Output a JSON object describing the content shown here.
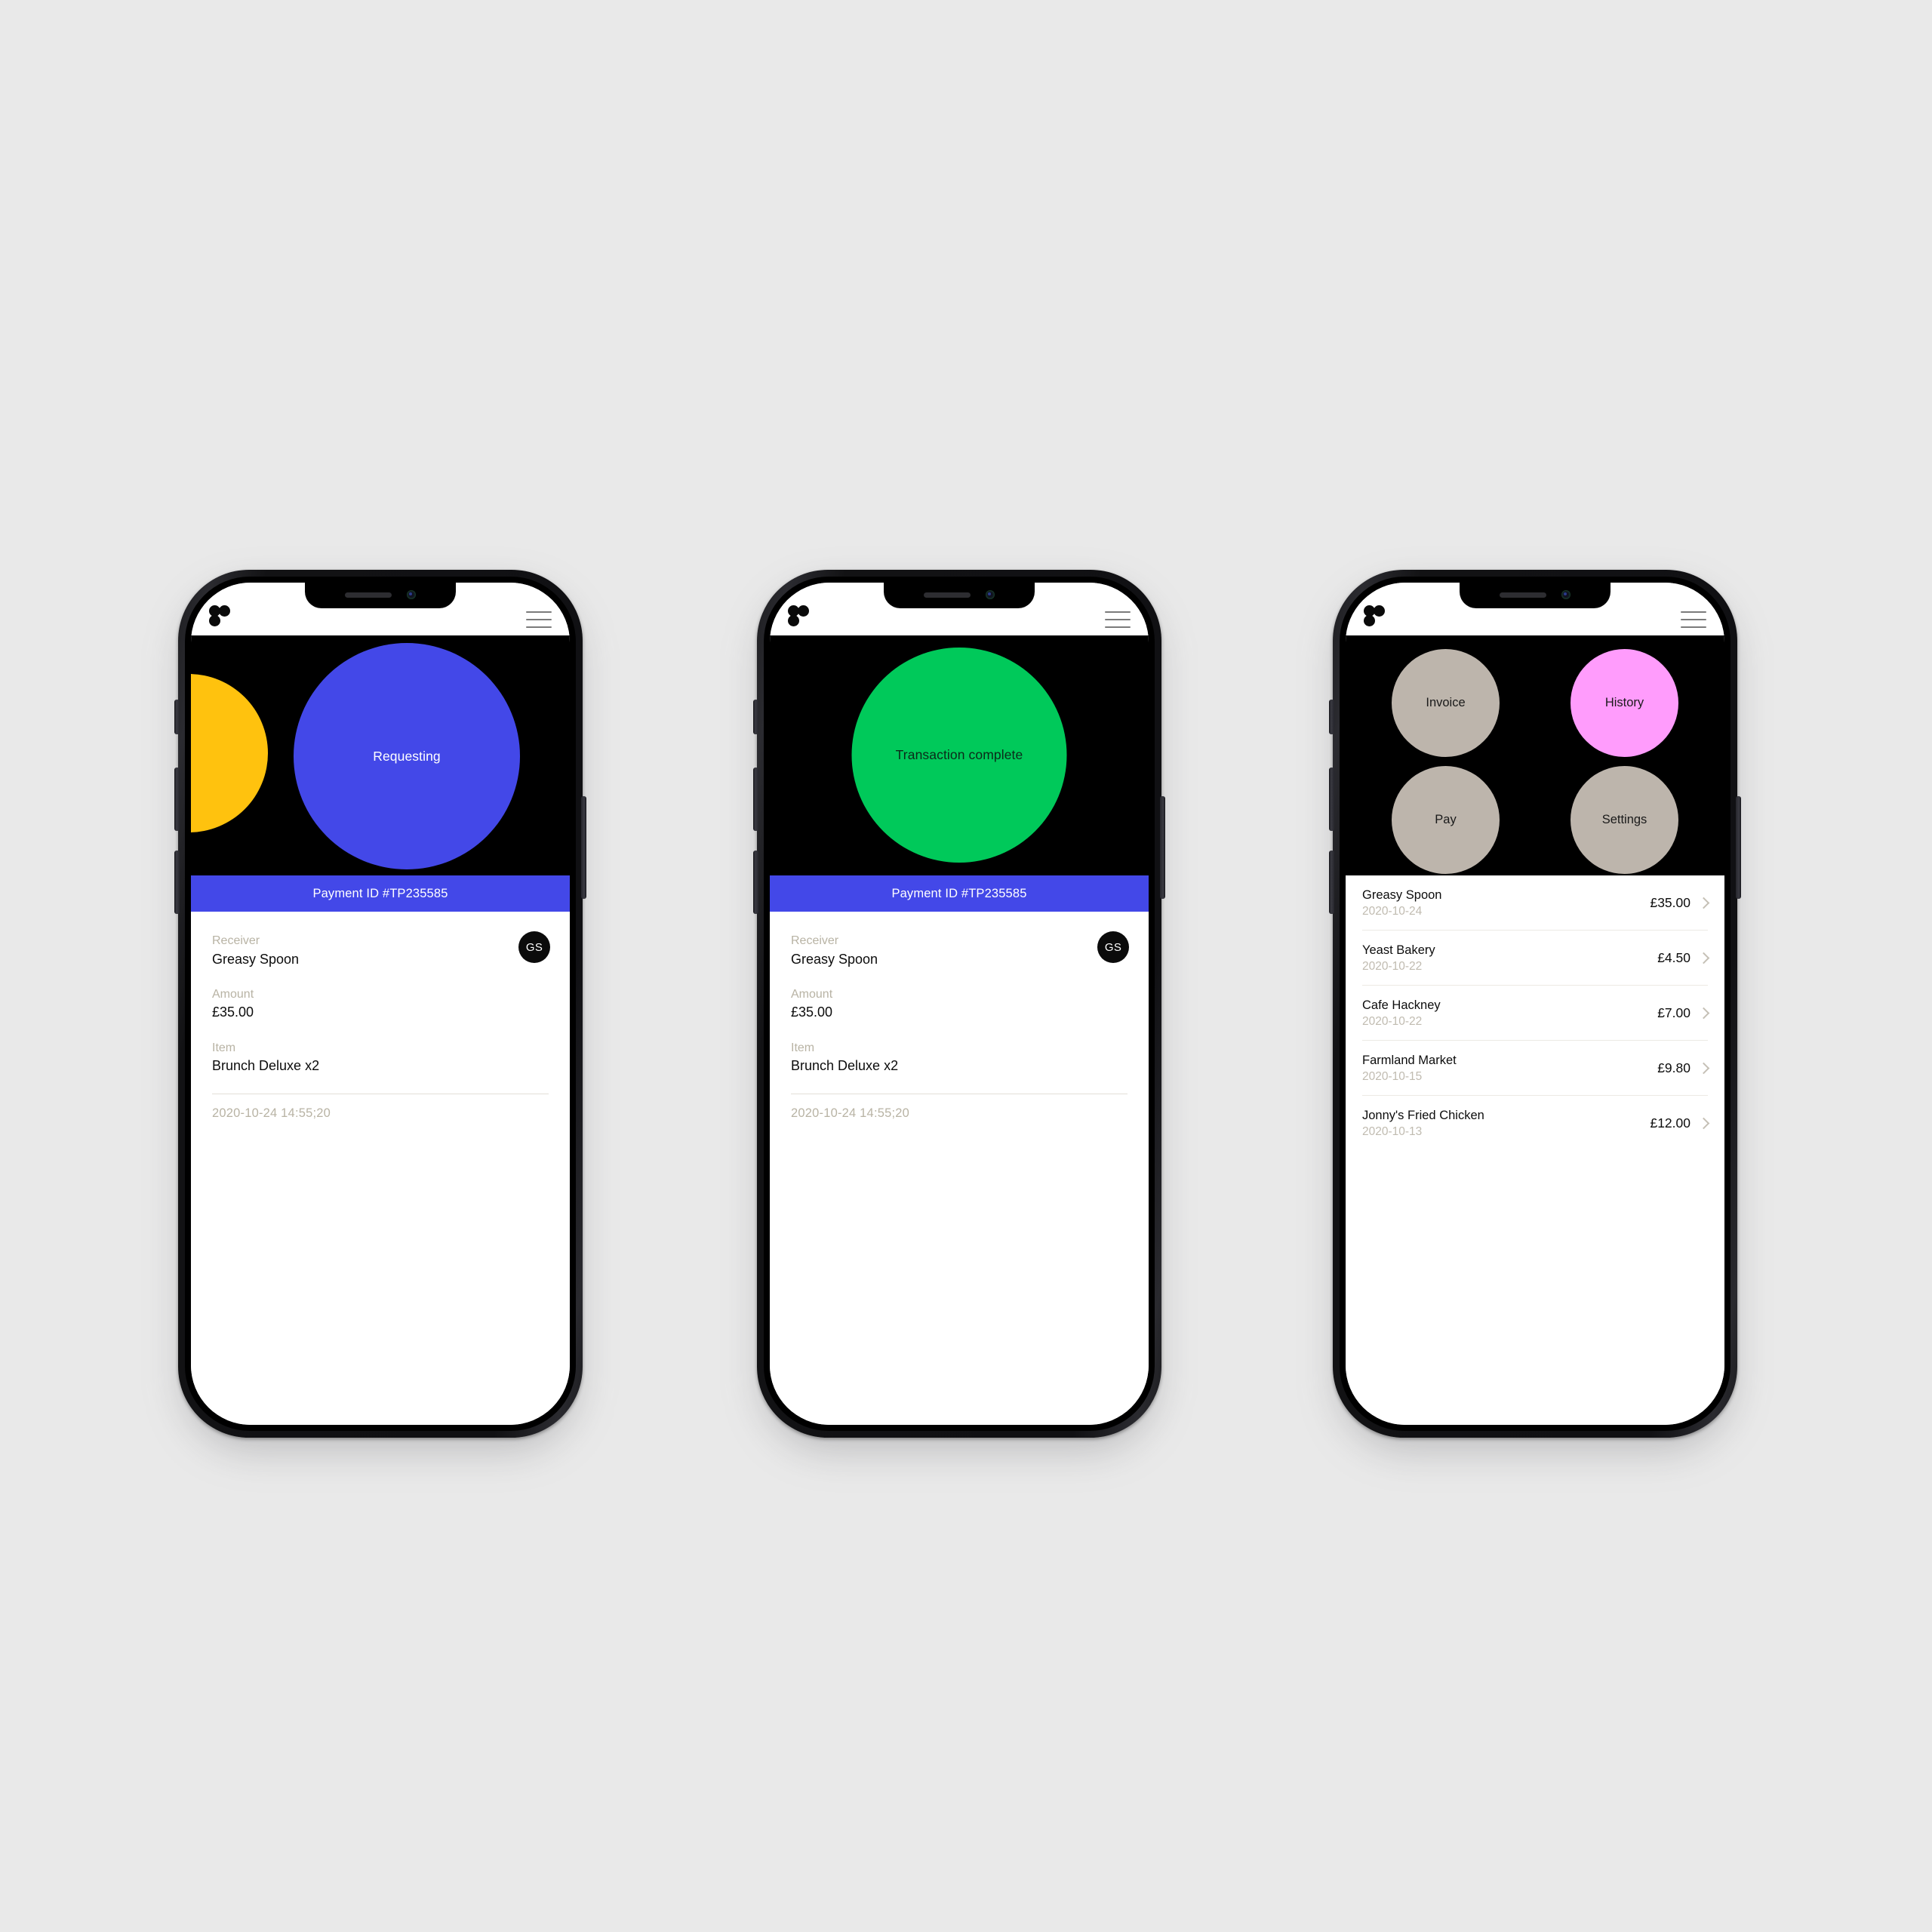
{
  "brand": {
    "logo_name": "three-dots-logo",
    "menu_icon": "hamburger-menu-icon"
  },
  "colors": {
    "blue": "#4348e8",
    "yellow": "#ffc20e",
    "green": "#00c95a",
    "pink": "#ff9cfc",
    "beige": "#bdb5ac",
    "black": "#000000",
    "white": "#ffffff",
    "muted_text": "#b8b3a4"
  },
  "screens": [
    {
      "id": "requesting",
      "status_label": "Requesting",
      "payment_id": "Payment ID #TP235585",
      "details": {
        "receiver_label": "Receiver",
        "receiver_value": "Greasy Spoon",
        "amount_label": "Amount",
        "amount_value": "£35.00",
        "item_label": "Item",
        "item_value": "Brunch Deluxe x2",
        "avatar_initials": "GS",
        "timestamp": "2020-10-24  14:55;20"
      }
    },
    {
      "id": "complete",
      "status_label": "Transaction complete",
      "payment_id": "Payment ID #TP235585",
      "details": {
        "receiver_label": "Receiver",
        "receiver_value": "Greasy Spoon",
        "amount_label": "Amount",
        "amount_value": "£35.00",
        "item_label": "Item",
        "item_value": "Brunch Deluxe x2",
        "avatar_initials": "GS",
        "timestamp": "2020-10-24  14:55;20"
      }
    },
    {
      "id": "home",
      "menu": [
        {
          "label": "Invoice",
          "color": "#bdb5ac"
        },
        {
          "label": "History",
          "color": "#ff9cfc"
        },
        {
          "label": "Pay",
          "color": "#bdb5ac"
        },
        {
          "label": "Settings",
          "color": "#bdb5ac"
        }
      ],
      "transactions": [
        {
          "name": "Greasy Spoon",
          "date": "2020-10-24",
          "amount": "£35.00"
        },
        {
          "name": "Yeast Bakery",
          "date": "2020-10-22",
          "amount": "£4.50"
        },
        {
          "name": "Cafe Hackney",
          "date": "2020-10-22",
          "amount": "£7.00"
        },
        {
          "name": "Farmland Market",
          "date": "2020-10-15",
          "amount": "£9.80"
        },
        {
          "name": "Jonny's Fried Chicken",
          "date": "2020-10-13",
          "amount": "£12.00"
        }
      ]
    }
  ]
}
